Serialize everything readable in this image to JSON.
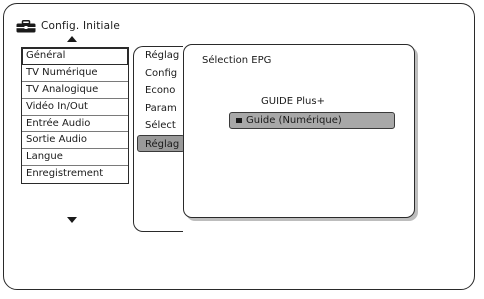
{
  "header": {
    "icon": "toolbox-icon",
    "title": "Config. Initiale"
  },
  "menu": {
    "items": [
      {
        "label": "Général",
        "selected": true
      },
      {
        "label": "TV Numérique"
      },
      {
        "label": "TV Analogique"
      },
      {
        "label": "Vidéo In/Out"
      },
      {
        "label": "Entrée Audio"
      },
      {
        "label": "Sortie Audio"
      },
      {
        "label": "Langue"
      },
      {
        "label": "Enregistrement"
      }
    ]
  },
  "submenu": {
    "items": [
      {
        "label": "Réglag"
      },
      {
        "label": "Config"
      },
      {
        "label": "Econo"
      },
      {
        "label": "Param"
      },
      {
        "label": "Sélect"
      },
      {
        "label": "Réglag",
        "highlighted": true
      }
    ]
  },
  "panel": {
    "title": "Sélection EPG",
    "options": [
      {
        "label": "GUIDE Plus+"
      },
      {
        "label": "Guide (Numérique)",
        "selected": true
      }
    ]
  },
  "colors": {
    "border": "#2a2a2a",
    "highlight": "#a8a8a8",
    "background": "#ffffff"
  }
}
